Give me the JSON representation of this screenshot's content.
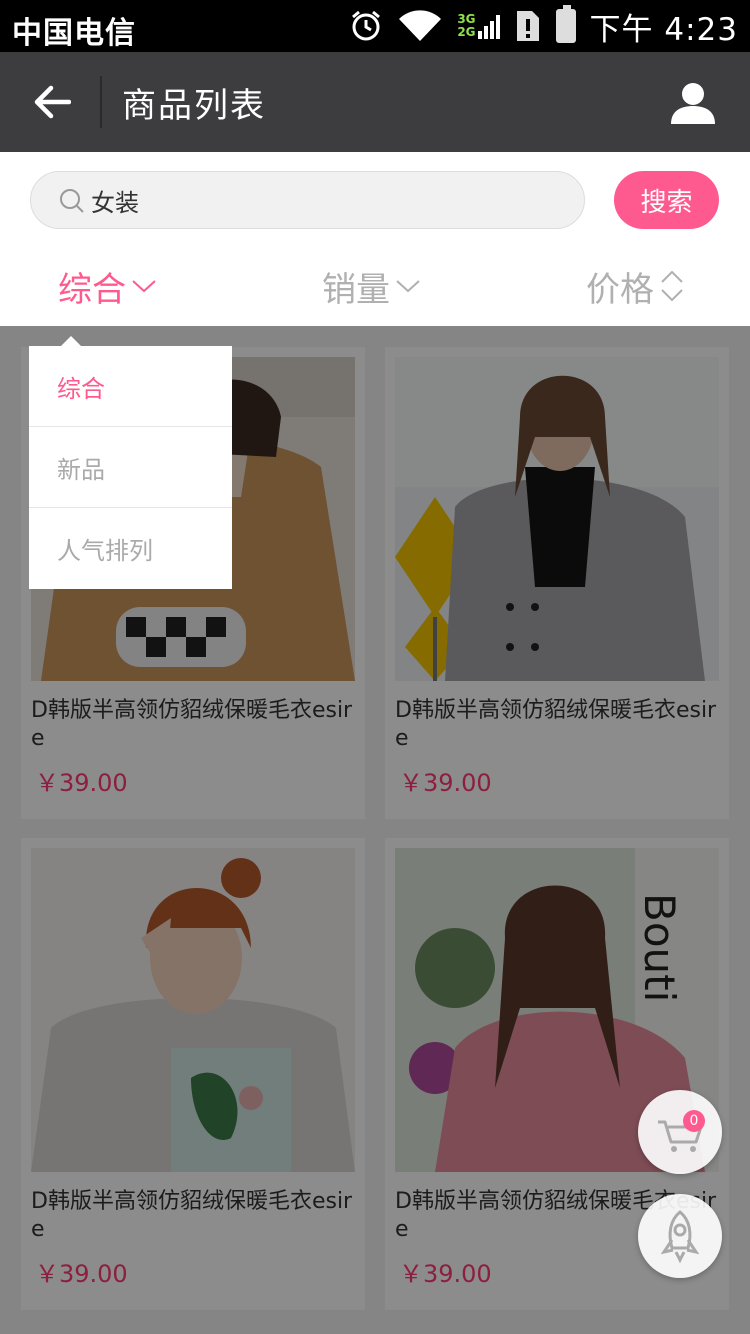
{
  "status_bar": {
    "carrier": "中国电信",
    "network_3g": "3G",
    "network_2g": "2G",
    "time": "下午 4:23"
  },
  "header": {
    "title": "商品列表",
    "back_icon": "arrow-left-icon",
    "user_icon": "user-icon"
  },
  "search": {
    "value": "女装",
    "button_label": "搜索"
  },
  "sort_tabs": [
    {
      "label": "综合",
      "active": true
    },
    {
      "label": "销量",
      "active": false
    },
    {
      "label": "价格",
      "active": false
    }
  ],
  "dropdown": {
    "items": [
      "综合",
      "新品",
      "人气排列"
    ],
    "selected": "综合"
  },
  "products": [
    {
      "name": "D韩版半高领仿貂绒保暖毛衣esire",
      "price": "￥39.00"
    },
    {
      "name": "D韩版半高领仿貂绒保暖毛衣esire",
      "price": "￥39.00"
    },
    {
      "name": "D韩版半高领仿貂绒保暖毛衣esire",
      "price": "￥39.00"
    },
    {
      "name": "D韩版半高领仿貂绒保暖毛衣esire",
      "price": "￥39.00"
    }
  ],
  "cart": {
    "count": "0"
  },
  "colors": {
    "accent": "#ff5a8f",
    "price": "#ff3a73",
    "header_bg": "#3d3d3f"
  }
}
